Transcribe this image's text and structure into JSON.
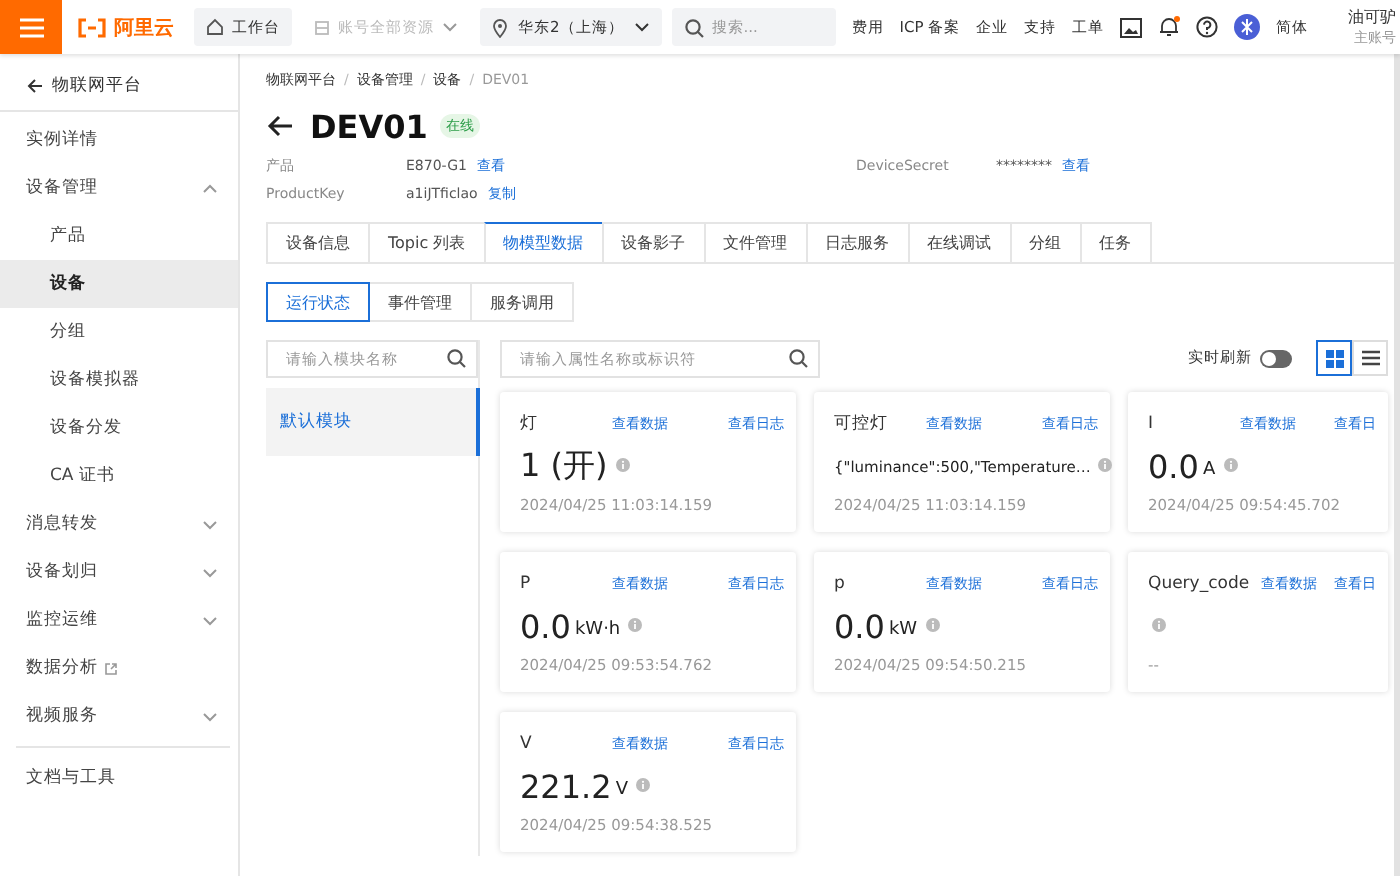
{
  "topbar": {
    "logo": "阿里云",
    "workbench": "工作台",
    "account_scope": {
      "label": "账号全部资源",
      "disabled": true
    },
    "region": "华东2（上海）",
    "search": {
      "placeholder": "搜索..."
    },
    "links": [
      "费用",
      "ICP 备案",
      "企业",
      "支持",
      "工单"
    ],
    "notifications": {
      "unread": true
    },
    "language": "简体",
    "user": {
      "name": "油可驴",
      "role": "主账号"
    }
  },
  "sidebar": {
    "back": "物联网平台",
    "items": [
      {
        "label": "实例详情",
        "kind": "link",
        "selected": false
      },
      {
        "label": "设备管理",
        "kind": "group",
        "expanded": true,
        "selected": false,
        "children": [
          {
            "label": "产品",
            "selected": false
          },
          {
            "label": "设备",
            "selected": true
          },
          {
            "label": "分组",
            "selected": false
          },
          {
            "label": "设备模拟器",
            "selected": false
          },
          {
            "label": "设备分发",
            "selected": false
          },
          {
            "label": "CA 证书",
            "selected": false
          }
        ]
      },
      {
        "label": "消息转发",
        "kind": "group",
        "expanded": false,
        "selected": false
      },
      {
        "label": "设备划归",
        "kind": "group",
        "expanded": false,
        "selected": false
      },
      {
        "label": "监控运维",
        "kind": "group",
        "expanded": false,
        "selected": false
      },
      {
        "label": "数据分析",
        "kind": "external",
        "selected": false
      },
      {
        "label": "视频服务",
        "kind": "group",
        "expanded": false,
        "selected": false
      }
    ],
    "footer": "文档与工具"
  },
  "breadcrumb": {
    "separator": "/",
    "items": [
      "物联网平台",
      "设备管理",
      "设备",
      "DEV01"
    ]
  },
  "device": {
    "name": "DEV01",
    "status": "在线",
    "online": true
  },
  "info": [
    {
      "label": "产品",
      "value": "E870-G1",
      "action": "查看"
    },
    {
      "label": "DeviceSecret",
      "value": "********",
      "action": "查看"
    },
    {
      "label": "ProductKey",
      "value": "a1iJTficlao",
      "action": "复制"
    }
  ],
  "tabs": [
    {
      "label": "设备信息",
      "selected": false
    },
    {
      "label": "Topic 列表",
      "selected": false
    },
    {
      "label": "物模型数据",
      "selected": true
    },
    {
      "label": "设备影子",
      "selected": false
    },
    {
      "label": "文件管理",
      "selected": false
    },
    {
      "label": "日志服务",
      "selected": false
    },
    {
      "label": "在线调试",
      "selected": false
    },
    {
      "label": "分组",
      "selected": false
    },
    {
      "label": "任务",
      "selected": false
    }
  ],
  "subtabs": [
    {
      "label": "运行状态",
      "selected": true
    },
    {
      "label": "事件管理",
      "selected": false
    },
    {
      "label": "服务调用",
      "selected": false
    }
  ],
  "module_search": {
    "placeholder": "请输入模块名称"
  },
  "modules": [
    {
      "label": "默认模块",
      "selected": true
    }
  ],
  "property_search": {
    "placeholder": "请输入属性名称或标识符"
  },
  "realtime_refresh": {
    "label": "实时刷新",
    "on": false
  },
  "view_modes": [
    {
      "kind": "grid",
      "selected": true
    },
    {
      "kind": "list",
      "selected": false
    }
  ],
  "cards": [
    {
      "name": "灯",
      "kind": "number",
      "value": "1 (开)",
      "time": "2024/04/25 11:03:14.159",
      "data_link": "查看数据",
      "log_link": "查看日志"
    },
    {
      "name": "可控灯",
      "kind": "json",
      "value": "{\"luminance\":500,\"Temperature…",
      "time": "2024/04/25 11:03:14.159",
      "data_link": "查看数据",
      "log_link": "查看日志"
    },
    {
      "name": "I",
      "kind": "number",
      "value": "0.0",
      "unit": "A",
      "time": "2024/04/25 09:54:45.702",
      "data_link": "查看数据",
      "log_link": "查看日"
    },
    {
      "name": "P",
      "kind": "number",
      "value": "0.0",
      "unit": "kW·h",
      "time": "2024/04/25 09:53:54.762",
      "data_link": "查看数据",
      "log_link": "查看日志"
    },
    {
      "name": "p",
      "kind": "number",
      "value": "0.0",
      "unit": "kW",
      "time": "2024/04/25 09:54:50.215",
      "data_link": "查看数据",
      "log_link": "查看日志"
    },
    {
      "name": "Query_code",
      "kind": "empty",
      "time": "--",
      "data_link": "查看数据",
      "log_link": "查看日"
    },
    {
      "name": "V",
      "kind": "number",
      "value": "221.2",
      "unit": "V",
      "time": "2024/04/25 09:54:38.525",
      "data_link": "查看数据",
      "log_link": "查看日志"
    }
  ]
}
